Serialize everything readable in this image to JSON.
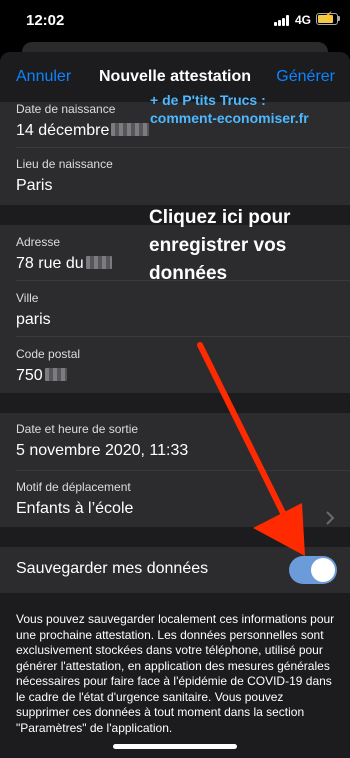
{
  "status_bar": {
    "time": "12:02",
    "network": "4G"
  },
  "nav": {
    "cancel": "Annuler",
    "title": "Nouvelle attestation",
    "generate": "Générer"
  },
  "identity": {
    "birth_date_label": "Date de naissance",
    "birth_date_value": "14 décembre",
    "birth_place_label": "Lieu de naissance",
    "birth_place_value": "Paris"
  },
  "address": {
    "street_label": "Adresse",
    "street_value": "78 rue du",
    "city_label": "Ville",
    "city_value": "paris",
    "postal_label": "Code postal",
    "postal_value": "750"
  },
  "trip": {
    "datetime_label": "Date et heure de sortie",
    "datetime_value": "5 novembre 2020, 11:33",
    "reason_label": "Motif de déplacement",
    "reason_value": "Enfants à l’école"
  },
  "save": {
    "label": "Sauvegarder mes données",
    "enabled": true
  },
  "footnote": "Vous pouvez sauvegarder localement ces informations pour une prochaine attestation. Les données personnelles sont exclusivement stockées dans votre téléphone, utilisé pour générer l'attestation, en application des mesures générales nécessaires pour faire face à l'épidémie de COVID-19 dans le cadre de l'état d'urgence sanitaire. Vous pouvez supprimer ces données à tout moment dans la section \"Paramètres\" de l'application.",
  "overlay": {
    "brand_line1": "+ de P'tits Trucs :",
    "brand_line2": "comment-economiser.fr",
    "callout_line1": "Cliquez ici pour",
    "callout_line2": "enregistrer vos",
    "callout_line3": "données"
  },
  "colors": {
    "accent": "#0a84ff",
    "toggle_on": "#6b9bd8",
    "arrow": "#ff2a00",
    "brand": "#4db8ff"
  }
}
